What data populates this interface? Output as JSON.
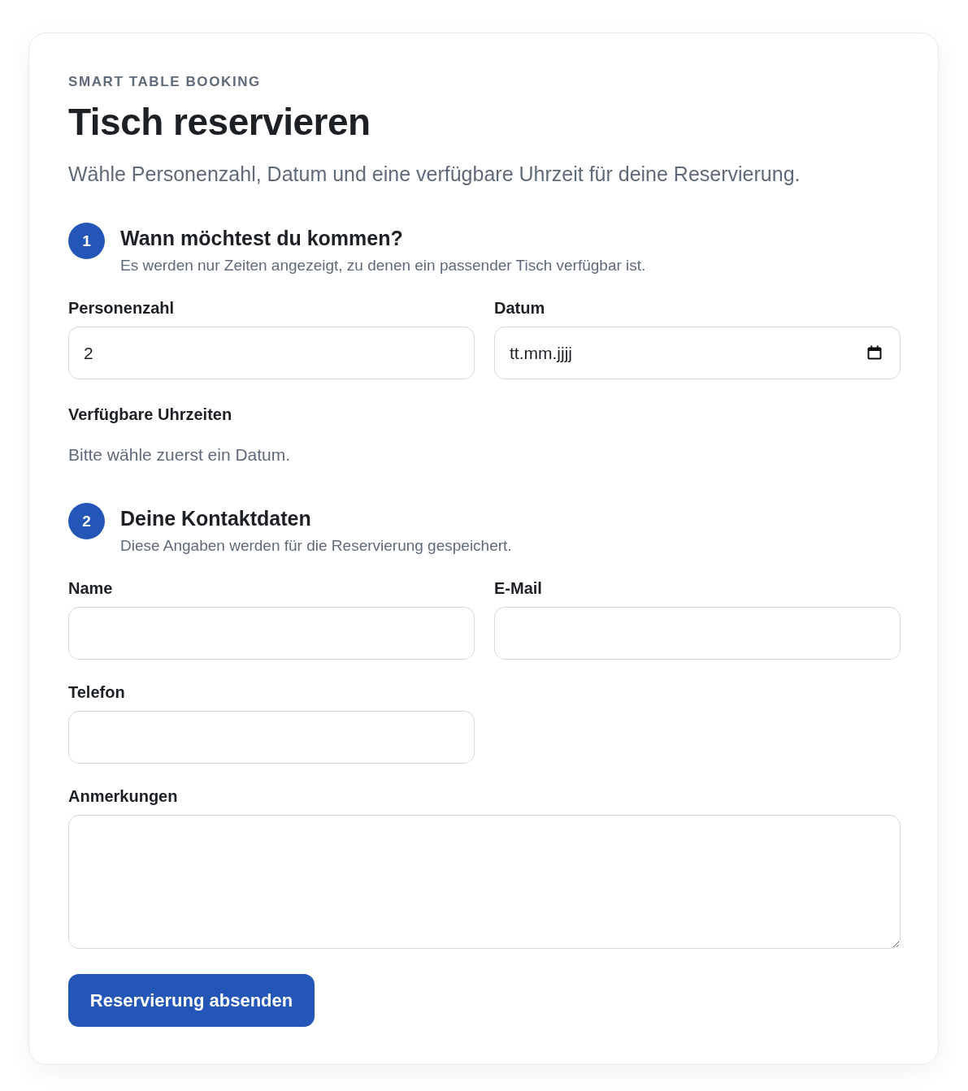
{
  "header": {
    "eyebrow": "SMART TABLE BOOKING",
    "title": "Tisch reservieren",
    "intro": "Wähle Personenzahl, Datum und eine verfügbare Uhrzeit für deine Reservierung."
  },
  "steps": [
    {
      "number": "1",
      "title": "Wann möchtest du kommen?",
      "subtitle": "Es werden nur Zeiten angezeigt, zu denen ein passender Tisch verfügbar ist.",
      "fields": [
        {
          "kind": "number",
          "label": "Personenzahl",
          "value": "2"
        },
        {
          "kind": "date",
          "label": "Datum",
          "placeholder": "tt.mm.jjjj"
        },
        {
          "kind": "notice",
          "label": "Verfügbare Uhrzeiten",
          "message": "Bitte wähle zuerst ein Datum."
        }
      ]
    },
    {
      "number": "2",
      "title": "Deine Kontaktdaten",
      "subtitle": "Diese Angaben werden für die Reservierung gespeichert.",
      "fields": [
        {
          "kind": "text",
          "label": "Name"
        },
        {
          "kind": "email",
          "label": "E-Mail"
        },
        {
          "kind": "tel",
          "label": "Telefon"
        },
        {
          "kind": "textarea",
          "label": "Anmerkungen"
        }
      ]
    }
  ],
  "submit": {
    "label": "Reservierung absenden"
  }
}
